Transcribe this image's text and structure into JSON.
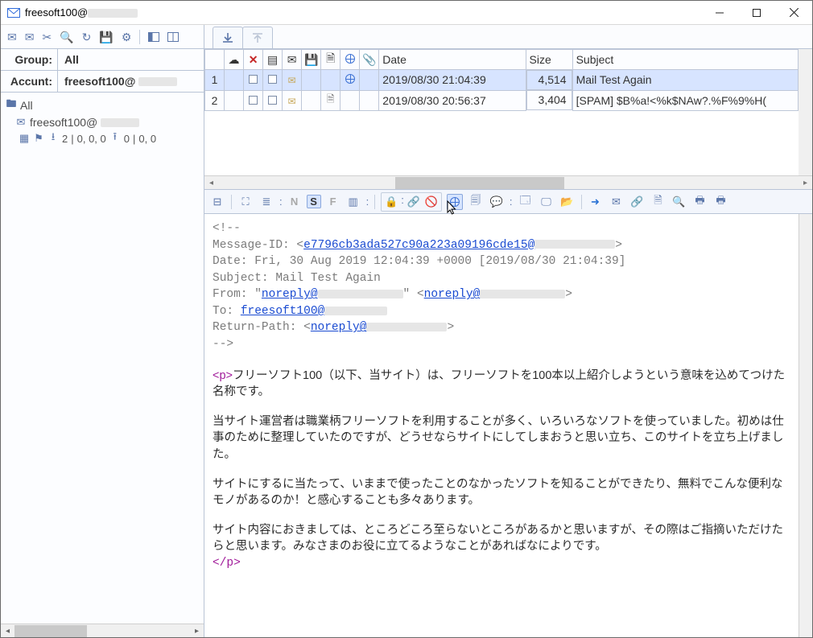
{
  "window": {
    "title_prefix": "freesoft100@"
  },
  "left": {
    "group_label": "Group:",
    "group_value": "All",
    "account_label": "Accunt:",
    "account_value_prefix": "freesoft100@",
    "tree_root": "All",
    "tree_account_prefix": "freesoft100@",
    "stats_dl": "2",
    "stats_triplet": "0, 0, 0",
    "stats_ul": "0",
    "stats_pair": "0, 0"
  },
  "list": {
    "headers": {
      "date": "Date",
      "size": "Size",
      "subject": "Subject"
    },
    "rows": [
      {
        "idx": "1",
        "date": "2019/08/30 21:04:39",
        "size": "4,514",
        "subject": "Mail Test Again",
        "globe": true,
        "selected": true,
        "doc": false
      },
      {
        "idx": "2",
        "date": "2019/08/30 20:56:37",
        "size": "3,404",
        "subject": "[SPAM] $B%a!<%k$NAw?.%F%9%H(",
        "globe": false,
        "selected": false,
        "doc": true
      }
    ]
  },
  "toolbar2": {
    "n": "N",
    "s": "S",
    "f": "F"
  },
  "message": {
    "comment_open": "<!--",
    "msgid_label": "Message-ID: <",
    "msgid_link": "e7796cb3ada527c90a223a09196cde15@",
    "msgid_close": ">",
    "date_line": "Date: Fri, 30 Aug 2019 12:04:39 +0000 [2019/08/30 21:04:39]",
    "subject_line": "Subject: Mail Test Again",
    "from_label": "From: \"",
    "from_link1": "noreply@",
    "from_mid": "\" <",
    "from_link2": "noreply@",
    "from_close": ">",
    "to_label": "To: ",
    "to_link": "freesoft100@",
    "rp_label": "Return-Path: <",
    "rp_link": "noreply@",
    "rp_close": ">",
    "comment_close": "-->",
    "ptag_open": "<p>",
    "para1": "フリーソフト100（以下、当サイト）は、フリーソフトを100本以上紹介しようという意味を込めてつけた名称です。",
    "para2": "当サイト運営者は職業柄フリーソフトを利用することが多く、いろいろなソフトを使っていました。初めは仕事のために整理していたのですが、どうせならサイトにしてしまおうと思い立ち、このサイトを立ち上げました。",
    "para3": "サイトにするに当たって、いままで使ったことのなかったソフトを知ることができたり、無料でこんな便利なモノがあるのか！と感心することも多々あります。",
    "para4": "サイト内容におきましては、ところどころ至らないところがあるかと思いますが、その際はご指摘いただけたらと思います。みなさまのお役に立てるようなことがあればなによりです。",
    "ptag_close": "</p>"
  }
}
